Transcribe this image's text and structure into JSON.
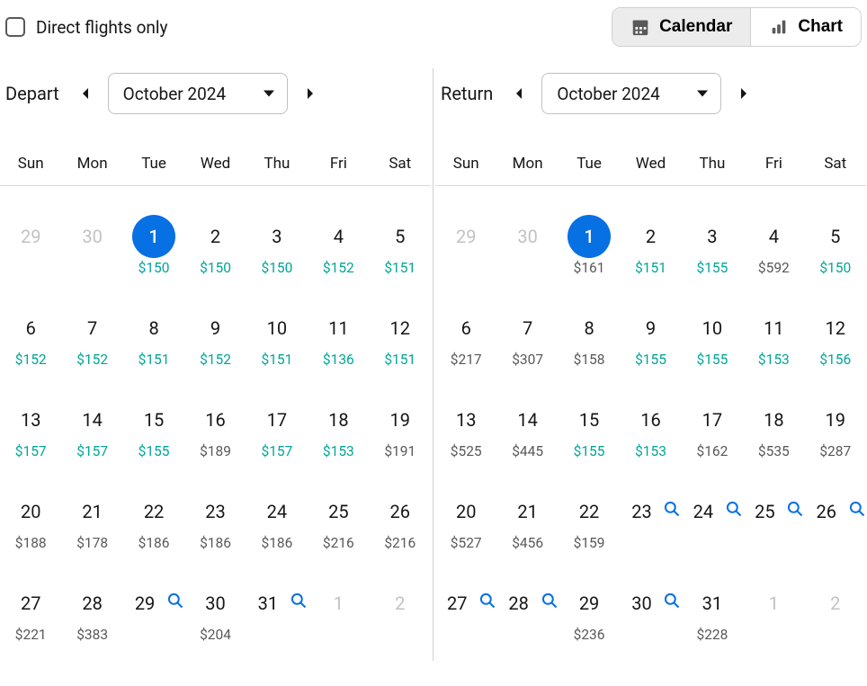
{
  "direct_flights_label": "Direct flights only",
  "view_toggle": {
    "calendar": "Calendar",
    "chart": "Chart"
  },
  "weekdays": [
    "Sun",
    "Mon",
    "Tue",
    "Wed",
    "Thu",
    "Fri",
    "Sat"
  ],
  "depart": {
    "title": "Depart",
    "month_label": "October 2024",
    "cells": [
      {
        "day": "29",
        "kind": "prev"
      },
      {
        "day": "30",
        "kind": "prev"
      },
      {
        "day": "1",
        "selected": true,
        "price": "$150",
        "cheap": true
      },
      {
        "day": "2",
        "price": "$150",
        "cheap": true
      },
      {
        "day": "3",
        "price": "$150",
        "cheap": true
      },
      {
        "day": "4",
        "price": "$152",
        "cheap": true
      },
      {
        "day": "5",
        "price": "$151",
        "cheap": true
      },
      {
        "day": "6",
        "price": "$152",
        "cheap": true
      },
      {
        "day": "7",
        "price": "$152",
        "cheap": true
      },
      {
        "day": "8",
        "price": "$151",
        "cheap": true
      },
      {
        "day": "9",
        "price": "$152",
        "cheap": true
      },
      {
        "day": "10",
        "price": "$151",
        "cheap": true
      },
      {
        "day": "11",
        "price": "$136",
        "cheap": true
      },
      {
        "day": "12",
        "price": "$151",
        "cheap": true
      },
      {
        "day": "13",
        "price": "$157",
        "cheap": true
      },
      {
        "day": "14",
        "price": "$157",
        "cheap": true
      },
      {
        "day": "15",
        "price": "$155",
        "cheap": true
      },
      {
        "day": "16",
        "price": "$189",
        "cheap": false
      },
      {
        "day": "17",
        "price": "$157",
        "cheap": true
      },
      {
        "day": "18",
        "price": "$153",
        "cheap": true
      },
      {
        "day": "19",
        "price": "$191",
        "cheap": false
      },
      {
        "day": "20",
        "price": "$188",
        "cheap": false
      },
      {
        "day": "21",
        "price": "$178",
        "cheap": false
      },
      {
        "day": "22",
        "price": "$186",
        "cheap": false
      },
      {
        "day": "23",
        "price": "$186",
        "cheap": false
      },
      {
        "day": "24",
        "price": "$186",
        "cheap": false
      },
      {
        "day": "25",
        "price": "$216",
        "cheap": false
      },
      {
        "day": "26",
        "price": "$216",
        "cheap": false
      },
      {
        "day": "27",
        "price": "$221",
        "cheap": false
      },
      {
        "day": "28",
        "price": "$383",
        "cheap": false
      },
      {
        "day": "29",
        "search": true
      },
      {
        "day": "30",
        "price": "$204",
        "cheap": false
      },
      {
        "day": "31",
        "search": true
      },
      {
        "day": "1",
        "kind": "next"
      },
      {
        "day": "2",
        "kind": "next"
      }
    ]
  },
  "return": {
    "title": "Return",
    "month_label": "October 2024",
    "cells": [
      {
        "day": "29",
        "kind": "prev"
      },
      {
        "day": "30",
        "kind": "prev"
      },
      {
        "day": "1",
        "selected": true,
        "price": "$161",
        "cheap": false
      },
      {
        "day": "2",
        "price": "$151",
        "cheap": true
      },
      {
        "day": "3",
        "price": "$155",
        "cheap": true
      },
      {
        "day": "4",
        "price": "$592",
        "cheap": false
      },
      {
        "day": "5",
        "price": "$150",
        "cheap": true
      },
      {
        "day": "6",
        "price": "$217",
        "cheap": false
      },
      {
        "day": "7",
        "price": "$307",
        "cheap": false
      },
      {
        "day": "8",
        "price": "$158",
        "cheap": false
      },
      {
        "day": "9",
        "price": "$155",
        "cheap": true
      },
      {
        "day": "10",
        "price": "$155",
        "cheap": true
      },
      {
        "day": "11",
        "price": "$153",
        "cheap": true
      },
      {
        "day": "12",
        "price": "$156",
        "cheap": true
      },
      {
        "day": "13",
        "price": "$525",
        "cheap": false
      },
      {
        "day": "14",
        "price": "$445",
        "cheap": false
      },
      {
        "day": "15",
        "price": "$155",
        "cheap": true
      },
      {
        "day": "16",
        "price": "$153",
        "cheap": true
      },
      {
        "day": "17",
        "price": "$162",
        "cheap": false
      },
      {
        "day": "18",
        "price": "$535",
        "cheap": false
      },
      {
        "day": "19",
        "price": "$287",
        "cheap": false
      },
      {
        "day": "20",
        "price": "$527",
        "cheap": false
      },
      {
        "day": "21",
        "price": "$456",
        "cheap": false
      },
      {
        "day": "22",
        "price": "$159",
        "cheap": false
      },
      {
        "day": "23",
        "search": true
      },
      {
        "day": "24",
        "search": true
      },
      {
        "day": "25",
        "search": true
      },
      {
        "day": "26",
        "search": true
      },
      {
        "day": "27",
        "search": true
      },
      {
        "day": "28",
        "search": true
      },
      {
        "day": "29",
        "price": "$236",
        "cheap": false
      },
      {
        "day": "30",
        "search": true
      },
      {
        "day": "31",
        "price": "$228",
        "cheap": false
      },
      {
        "day": "1",
        "kind": "next"
      },
      {
        "day": "2",
        "kind": "next"
      }
    ]
  }
}
